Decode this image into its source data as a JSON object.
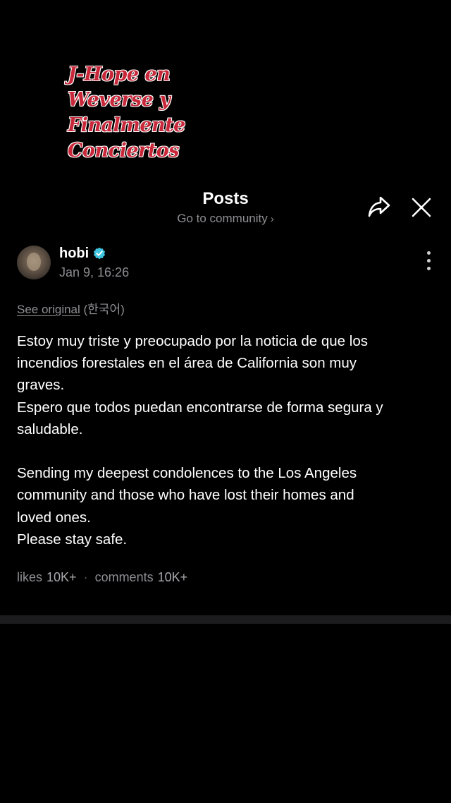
{
  "overlay": {
    "lines": [
      "J-Hope en",
      "Weverse y",
      "Finalmente",
      "Conciertos"
    ]
  },
  "header": {
    "title": "Posts",
    "community_link": "Go to community",
    "chevron": "›"
  },
  "actions": {
    "share_icon": "share-arrow-icon",
    "close_icon": "close-icon"
  },
  "post": {
    "author": "hobi",
    "verified": true,
    "date": "Jan 9, 16:26",
    "see_original": "See original",
    "original_language": "(한국어)",
    "body": "Estoy muy triste y preocupado por la noticia de que los\nincendios forestales en el área de California son muy\ngraves.\nEspero que todos puedan encontrarse de forma segura y\nsaludable.\n\nSending my deepest condolences to the Los Angeles\ncommunity and those who have lost their homes and\nloved ones.\nPlease stay safe.",
    "likes_label": "likes",
    "likes_count": "10K+",
    "separator": "·",
    "comments_label": "comments",
    "comments_count": "10K+"
  },
  "colors": {
    "background": "#000000",
    "secondary_text": "#8e8e93",
    "verified_badge": "#3ec6e0",
    "overlay_text": "#c8283a"
  }
}
